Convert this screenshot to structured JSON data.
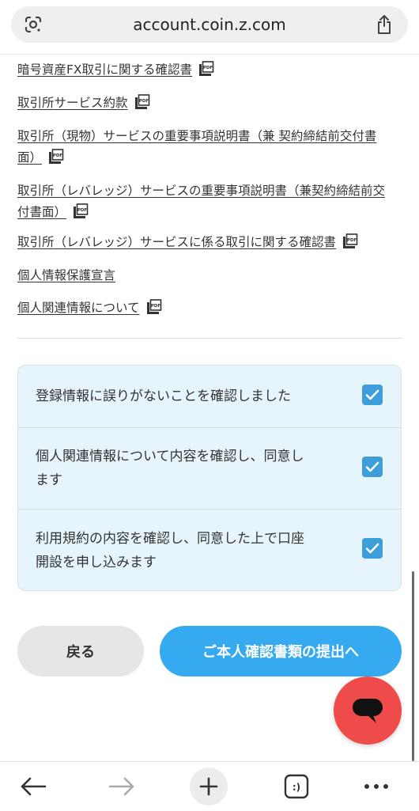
{
  "browser": {
    "url": "account.coin.z.com"
  },
  "documents": [
    {
      "label": "暗号資産FX取引に関する確認書",
      "pdf": true
    },
    {
      "label": "取引所サービス約款",
      "pdf": true
    },
    {
      "label_line1": "取引所（現物）サービスの重要事項説明書（兼 契約締結前交付書",
      "label_line2": "面）",
      "pdf": true
    },
    {
      "label_line1": "取引所（レバレッジ）サービスの重要事項説明書（兼契約締結前交",
      "label_line2": "付書面）",
      "pdf": true
    },
    {
      "label": "取引所（レバレッジ）サービスに係る取引に関する確認書",
      "pdf": true
    },
    {
      "label": "個人情報保護宣言",
      "pdf": false
    },
    {
      "label": "個人関連情報について",
      "pdf": true
    }
  ],
  "confirmations": [
    {
      "line1": "登録情報に誤りがないことを確認しました",
      "checked": true
    },
    {
      "line1": "個人関連情報について内容を確認し、同意し",
      "line2": "ます",
      "checked": true
    },
    {
      "line1": "利用規約の内容を確認し、同意した上で口座",
      "line2": "開設を申し込みます",
      "checked": true
    }
  ],
  "buttons": {
    "back": "戻る",
    "next": "ご本人確認書類の提出へ"
  },
  "colors": {
    "primary": "#35aaf1",
    "checkbox": "#3d9ed9",
    "panel_bg": "#e6f4fc",
    "chat_fab": "#f04b4b"
  },
  "icons": {
    "lens": "google-lens-icon",
    "share": "share-icon",
    "pdf": "pdf-icon",
    "chat": "chat-bubble-icon",
    "back": "arrow-left-icon",
    "forward": "arrow-right-icon",
    "new_tab": "plus-icon",
    "tabs": "tab-switcher-icon",
    "menu": "more-horizontal-icon"
  }
}
